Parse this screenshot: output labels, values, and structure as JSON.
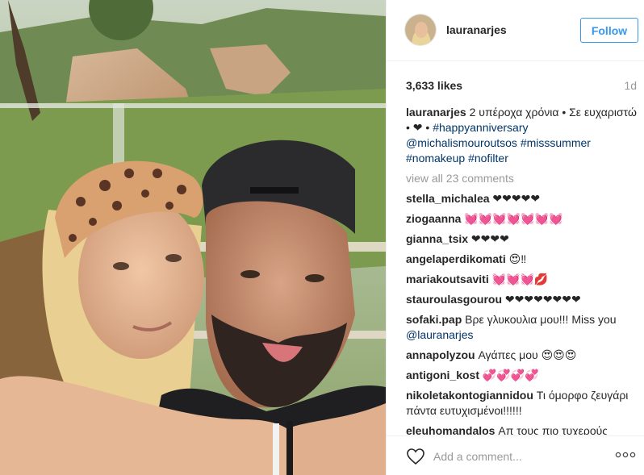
{
  "post": {
    "username": "lauranarjes",
    "follow_label": "Follow",
    "likes": "3,633 likes",
    "time_ago": "1d",
    "caption": {
      "user": "lauranarjes",
      "text": "2 υπέροχα χρόνια • Σε ευχαριστώ • ❤ •",
      "tags": [
        "#happyanniversary",
        "@michalismouroutsos",
        "#misssummer",
        "#nomakeup",
        "#nofilter"
      ]
    },
    "view_all": "view all 23 comments",
    "comments": [
      {
        "user": "stella_michalea",
        "text": "❤❤❤❤❤"
      },
      {
        "user": "ziogaanna",
        "text": "💓💓💓💓💓💓💓"
      },
      {
        "user": "gianna_tsix",
        "text": "❤❤❤❤"
      },
      {
        "user": "angelaperdikomati",
        "text": "😍‼"
      },
      {
        "user": "mariakoutsaviti",
        "text": "💓💓💓💋"
      },
      {
        "user": "stauroulasgourou",
        "text": "❤❤❤❤❤❤❤❤"
      },
      {
        "user": "sofaki.pap",
        "text": "Βρε γλυκουλια μου!!! Miss you",
        "mention": "@lauranarjes"
      },
      {
        "user": "annapolyzou",
        "text": "Αγάπες μου 😍😍😍"
      },
      {
        "user": "antigoni_kost",
        "text": "💞💞💞💞"
      },
      {
        "user": "nikoletakontogiannidou",
        "text": "Τι όμορφο ζευγάρι πάντα ευτυχισμένοι!!!!!!"
      },
      {
        "user": "eleuhomandalos",
        "text": "Απ τους πιο τυχερούς"
      }
    ],
    "add_comment_placeholder": "Add a comment...",
    "more_label": "ooo"
  }
}
